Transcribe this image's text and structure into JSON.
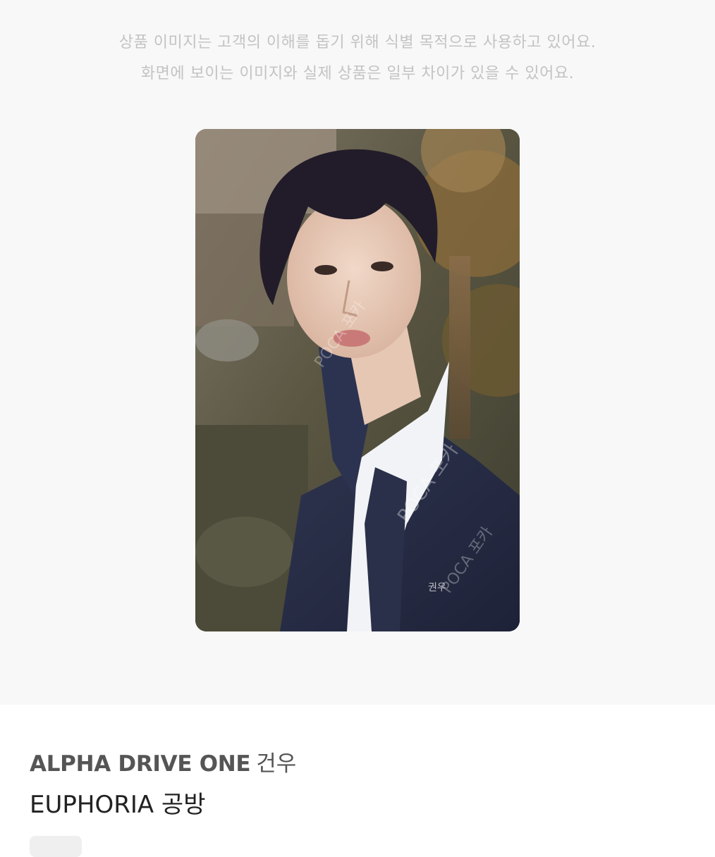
{
  "notice": {
    "line1": "상품 이미지는 고객의 이해를 돕기 위해 식별 목적으로 사용하고 있어요.",
    "line2": "화면에 보이는 이미지와 실제 상품은 일부 차이가 있을 수 있어요."
  },
  "product": {
    "image_name": "photocard-image",
    "watermark": "POCA 포카",
    "signature": "건우",
    "artist": "ALPHA DRIVE ONE",
    "member": "건우",
    "album": "EUPHORIA 공방"
  },
  "colors": {
    "background_top": "#f8f8f8",
    "notice_text": "#c3c3c3",
    "artist_text": "#555555",
    "title_text": "#222222",
    "chip": "#efefef"
  }
}
